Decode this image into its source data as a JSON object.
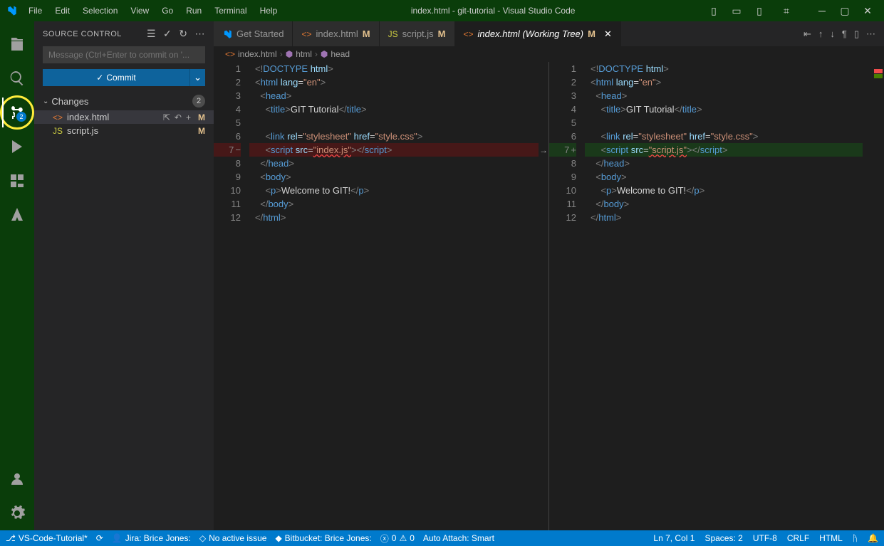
{
  "titlebar": {
    "menus": [
      "File",
      "Edit",
      "Selection",
      "View",
      "Go",
      "Run",
      "Terminal",
      "Help"
    ],
    "title": "index.html - git-tutorial - Visual Studio Code"
  },
  "activitybar": {
    "scm_badge": "2"
  },
  "sidebar": {
    "title": "SOURCE CONTROL",
    "commit_placeholder": "Message (Ctrl+Enter to commit on '...",
    "commit_button": "Commit",
    "changes_label": "Changes",
    "changes_count": "2",
    "files": [
      {
        "name": "index.html",
        "icon": "<>",
        "iconClass": "orange-icon",
        "status": "M",
        "selected": true
      },
      {
        "name": "script.js",
        "icon": "JS",
        "iconClass": "yellow-icon",
        "status": "M",
        "selected": false
      }
    ]
  },
  "tabs": [
    {
      "label": "Get Started",
      "icon": "vscode",
      "active": false,
      "modified": false
    },
    {
      "label": "index.html",
      "icon": "<>",
      "iconClass": "orange-icon",
      "active": false,
      "modified": true,
      "status": "M"
    },
    {
      "label": "script.js",
      "icon": "JS",
      "iconClass": "yellow-icon",
      "active": false,
      "modified": true,
      "status": "M"
    },
    {
      "label": "index.html (Working Tree)",
      "icon": "<>",
      "iconClass": "orange-icon",
      "active": true,
      "modified": true,
      "status": "M",
      "closable": true
    }
  ],
  "breadcrumb": [
    "index.html",
    "html",
    "head"
  ],
  "diff": {
    "left": {
      "lines": [
        {
          "n": "1",
          "html": "<span class='t-angle'>&lt;!</span><span class='t-doctype'>DOCTYPE</span> <span class='t-attr'>html</span><span class='t-angle'>&gt;</span>"
        },
        {
          "n": "2",
          "html": "<span class='t-angle'>&lt;</span><span class='t-tag'>html</span> <span class='t-attr'>lang</span>=<span class='t-str'>\"en\"</span><span class='t-angle'>&gt;</span>"
        },
        {
          "n": "3",
          "html": "  <span class='t-angle'>&lt;</span><span class='t-tag'>head</span><span class='t-angle'>&gt;</span>"
        },
        {
          "n": "4",
          "html": "    <span class='t-angle'>&lt;</span><span class='t-tag'>title</span><span class='t-angle'>&gt;</span><span class='t-text'>GIT Tutorial</span><span class='t-angle'>&lt;/</span><span class='t-tag'>title</span><span class='t-angle'>&gt;</span>"
        },
        {
          "n": "5",
          "html": ""
        },
        {
          "n": "6",
          "html": "    <span class='t-angle'>&lt;</span><span class='t-tag'>link</span> <span class='t-attr'>rel</span>=<span class='t-str'>\"stylesheet\"</span> <span class='t-attr'>href</span>=<span class='t-str'>\"style.css\"</span><span class='t-angle'>&gt;</span>"
        },
        {
          "n": "7",
          "html": "    <span class='t-angle'>&lt;</span><span class='t-tag'>script</span> <span class='t-attr'>src</span>=<span class='t-str t-err'>\"index.js\"</span><span class='t-angle'>&gt;&lt;/</span><span class='t-tag'>script</span><span class='t-angle'>&gt;</span>",
          "deleted": true
        },
        {
          "n": "8",
          "html": "  <span class='t-angle'>&lt;/</span><span class='t-tag'>head</span><span class='t-angle'>&gt;</span>"
        },
        {
          "n": "9",
          "html": "  <span class='t-angle'>&lt;</span><span class='t-tag'>body</span><span class='t-angle'>&gt;</span>"
        },
        {
          "n": "10",
          "html": "    <span class='t-angle'>&lt;</span><span class='t-tag'>p</span><span class='t-angle'>&gt;</span><span class='t-text'>Welcome to GIT!</span><span class='t-angle'>&lt;/</span><span class='t-tag'>p</span><span class='t-angle'>&gt;</span>"
        },
        {
          "n": "11",
          "html": "  <span class='t-angle'>&lt;/</span><span class='t-tag'>body</span><span class='t-angle'>&gt;</span>"
        },
        {
          "n": "12",
          "html": "<span class='t-angle'>&lt;/</span><span class='t-tag'>html</span><span class='t-angle'>&gt;</span>"
        }
      ]
    },
    "right": {
      "lines": [
        {
          "n": "1",
          "html": "<span class='t-angle'>&lt;!</span><span class='t-doctype'>DOCTYPE</span> <span class='t-attr'>html</span><span class='t-angle'>&gt;</span>"
        },
        {
          "n": "2",
          "html": "<span class='t-angle'>&lt;</span><span class='t-tag'>html</span> <span class='t-attr'>lang</span>=<span class='t-str'>\"en\"</span><span class='t-angle'>&gt;</span>"
        },
        {
          "n": "3",
          "html": "  <span class='t-angle'>&lt;</span><span class='t-tag'>head</span><span class='t-angle'>&gt;</span>"
        },
        {
          "n": "4",
          "html": "    <span class='t-angle'>&lt;</span><span class='t-tag'>title</span><span class='t-angle'>&gt;</span><span class='t-text'>GIT Tutorial</span><span class='t-angle'>&lt;/</span><span class='t-tag'>title</span><span class='t-angle'>&gt;</span>"
        },
        {
          "n": "5",
          "html": ""
        },
        {
          "n": "6",
          "html": "    <span class='t-angle'>&lt;</span><span class='t-tag'>link</span> <span class='t-attr'>rel</span>=<span class='t-str'>\"stylesheet\"</span> <span class='t-attr'>href</span>=<span class='t-str'>\"style.css\"</span><span class='t-angle'>&gt;</span>"
        },
        {
          "n": "7",
          "html": "    <span class='t-angle'>&lt;</span><span class='t-tag'>script</span> <span class='t-attr'>src</span>=<span class='t-str t-err'>\"script.js\"</span><span class='t-angle'>&gt;&lt;/</span><span class='t-tag'>script</span><span class='t-angle'>&gt;</span>",
          "added": true
        },
        {
          "n": "8",
          "html": "  <span class='t-angle'>&lt;/</span><span class='t-tag'>head</span><span class='t-angle'>&gt;</span>"
        },
        {
          "n": "9",
          "html": "  <span class='t-angle'>&lt;</span><span class='t-tag'>body</span><span class='t-angle'>&gt;</span>"
        },
        {
          "n": "10",
          "html": "    <span class='t-angle'>&lt;</span><span class='t-tag'>p</span><span class='t-angle'>&gt;</span><span class='t-text'>Welcome to GIT!</span><span class='t-angle'>&lt;/</span><span class='t-tag'>p</span><span class='t-angle'>&gt;</span>"
        },
        {
          "n": "11",
          "html": "  <span class='t-angle'>&lt;/</span><span class='t-tag'>body</span><span class='t-angle'>&gt;</span>"
        },
        {
          "n": "12",
          "html": "<span class='t-angle'>&lt;/</span><span class='t-tag'>html</span><span class='t-angle'>&gt;</span>"
        }
      ]
    }
  },
  "statusbar": {
    "branch": "VS-Code-Tutorial*",
    "jira": "Jira: Brice Jones:",
    "issue": "No active issue",
    "bitbucket": "Bitbucket: Brice Jones:",
    "errors": "0",
    "warnings": "0",
    "autoattach": "Auto Attach: Smart",
    "position": "Ln 7, Col 1",
    "spaces": "Spaces: 2",
    "encoding": "UTF-8",
    "eol": "CRLF",
    "lang": "HTML"
  }
}
